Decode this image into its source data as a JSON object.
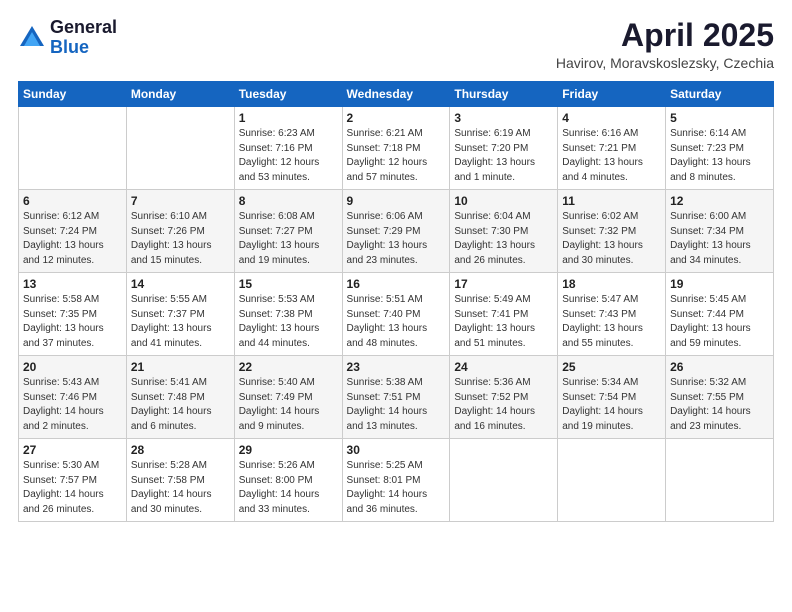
{
  "header": {
    "logo_general": "General",
    "logo_blue": "Blue",
    "month_title": "April 2025",
    "location": "Havirov, Moravskoslezsky, Czechia"
  },
  "weekdays": [
    "Sunday",
    "Monday",
    "Tuesday",
    "Wednesday",
    "Thursday",
    "Friday",
    "Saturday"
  ],
  "weeks": [
    [
      {
        "day": "",
        "info": ""
      },
      {
        "day": "",
        "info": ""
      },
      {
        "day": "1",
        "info": "Sunrise: 6:23 AM\nSunset: 7:16 PM\nDaylight: 12 hours\nand 53 minutes."
      },
      {
        "day": "2",
        "info": "Sunrise: 6:21 AM\nSunset: 7:18 PM\nDaylight: 12 hours\nand 57 minutes."
      },
      {
        "day": "3",
        "info": "Sunrise: 6:19 AM\nSunset: 7:20 PM\nDaylight: 13 hours\nand 1 minute."
      },
      {
        "day": "4",
        "info": "Sunrise: 6:16 AM\nSunset: 7:21 PM\nDaylight: 13 hours\nand 4 minutes."
      },
      {
        "day": "5",
        "info": "Sunrise: 6:14 AM\nSunset: 7:23 PM\nDaylight: 13 hours\nand 8 minutes."
      }
    ],
    [
      {
        "day": "6",
        "info": "Sunrise: 6:12 AM\nSunset: 7:24 PM\nDaylight: 13 hours\nand 12 minutes."
      },
      {
        "day": "7",
        "info": "Sunrise: 6:10 AM\nSunset: 7:26 PM\nDaylight: 13 hours\nand 15 minutes."
      },
      {
        "day": "8",
        "info": "Sunrise: 6:08 AM\nSunset: 7:27 PM\nDaylight: 13 hours\nand 19 minutes."
      },
      {
        "day": "9",
        "info": "Sunrise: 6:06 AM\nSunset: 7:29 PM\nDaylight: 13 hours\nand 23 minutes."
      },
      {
        "day": "10",
        "info": "Sunrise: 6:04 AM\nSunset: 7:30 PM\nDaylight: 13 hours\nand 26 minutes."
      },
      {
        "day": "11",
        "info": "Sunrise: 6:02 AM\nSunset: 7:32 PM\nDaylight: 13 hours\nand 30 minutes."
      },
      {
        "day": "12",
        "info": "Sunrise: 6:00 AM\nSunset: 7:34 PM\nDaylight: 13 hours\nand 34 minutes."
      }
    ],
    [
      {
        "day": "13",
        "info": "Sunrise: 5:58 AM\nSunset: 7:35 PM\nDaylight: 13 hours\nand 37 minutes."
      },
      {
        "day": "14",
        "info": "Sunrise: 5:55 AM\nSunset: 7:37 PM\nDaylight: 13 hours\nand 41 minutes."
      },
      {
        "day": "15",
        "info": "Sunrise: 5:53 AM\nSunset: 7:38 PM\nDaylight: 13 hours\nand 44 minutes."
      },
      {
        "day": "16",
        "info": "Sunrise: 5:51 AM\nSunset: 7:40 PM\nDaylight: 13 hours\nand 48 minutes."
      },
      {
        "day": "17",
        "info": "Sunrise: 5:49 AM\nSunset: 7:41 PM\nDaylight: 13 hours\nand 51 minutes."
      },
      {
        "day": "18",
        "info": "Sunrise: 5:47 AM\nSunset: 7:43 PM\nDaylight: 13 hours\nand 55 minutes."
      },
      {
        "day": "19",
        "info": "Sunrise: 5:45 AM\nSunset: 7:44 PM\nDaylight: 13 hours\nand 59 minutes."
      }
    ],
    [
      {
        "day": "20",
        "info": "Sunrise: 5:43 AM\nSunset: 7:46 PM\nDaylight: 14 hours\nand 2 minutes."
      },
      {
        "day": "21",
        "info": "Sunrise: 5:41 AM\nSunset: 7:48 PM\nDaylight: 14 hours\nand 6 minutes."
      },
      {
        "day": "22",
        "info": "Sunrise: 5:40 AM\nSunset: 7:49 PM\nDaylight: 14 hours\nand 9 minutes."
      },
      {
        "day": "23",
        "info": "Sunrise: 5:38 AM\nSunset: 7:51 PM\nDaylight: 14 hours\nand 13 minutes."
      },
      {
        "day": "24",
        "info": "Sunrise: 5:36 AM\nSunset: 7:52 PM\nDaylight: 14 hours\nand 16 minutes."
      },
      {
        "day": "25",
        "info": "Sunrise: 5:34 AM\nSunset: 7:54 PM\nDaylight: 14 hours\nand 19 minutes."
      },
      {
        "day": "26",
        "info": "Sunrise: 5:32 AM\nSunset: 7:55 PM\nDaylight: 14 hours\nand 23 minutes."
      }
    ],
    [
      {
        "day": "27",
        "info": "Sunrise: 5:30 AM\nSunset: 7:57 PM\nDaylight: 14 hours\nand 26 minutes."
      },
      {
        "day": "28",
        "info": "Sunrise: 5:28 AM\nSunset: 7:58 PM\nDaylight: 14 hours\nand 30 minutes."
      },
      {
        "day": "29",
        "info": "Sunrise: 5:26 AM\nSunset: 8:00 PM\nDaylight: 14 hours\nand 33 minutes."
      },
      {
        "day": "30",
        "info": "Sunrise: 5:25 AM\nSunset: 8:01 PM\nDaylight: 14 hours\nand 36 minutes."
      },
      {
        "day": "",
        "info": ""
      },
      {
        "day": "",
        "info": ""
      },
      {
        "day": "",
        "info": ""
      }
    ]
  ]
}
